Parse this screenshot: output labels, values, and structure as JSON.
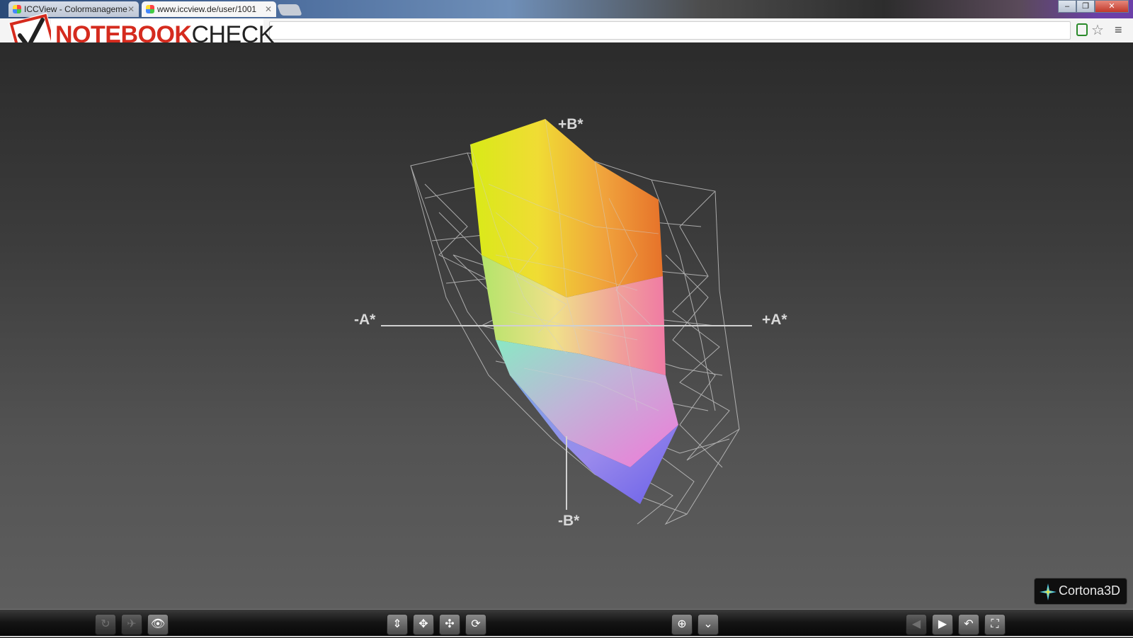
{
  "browser": {
    "tabs": [
      {
        "title": "ICCView - Colormanageme",
        "active": false
      },
      {
        "title": "www.iccview.de/user/1001",
        "active": true
      }
    ],
    "window_controls": [
      "minimize",
      "restore",
      "close"
    ],
    "icons": [
      "extension-icon",
      "bookmark-star-icon",
      "chrome-menu-icon"
    ]
  },
  "logo": {
    "part1": "NOTEBOOK",
    "part2": "CHECK"
  },
  "viewer": {
    "axes": {
      "plus_b": "+B*",
      "minus_a": "-A*",
      "plus_a": "+A*",
      "minus_b": "-B*"
    },
    "brand": "Cortona3D"
  },
  "navigation": {
    "left_group": [
      "walk-icon",
      "fly-icon",
      "study-icon"
    ],
    "center_group": [
      "plan-icon",
      "pan-icon",
      "turn-icon",
      "roll-icon"
    ],
    "right_group": [
      "goto-icon",
      "align-icon"
    ],
    "view_group": [
      "previous-view-icon",
      "next-view-icon",
      "restore-view-icon",
      "fit-view-icon"
    ]
  },
  "colors": {
    "accent_red": "#d52b1e",
    "background": "#3a3a3a"
  }
}
